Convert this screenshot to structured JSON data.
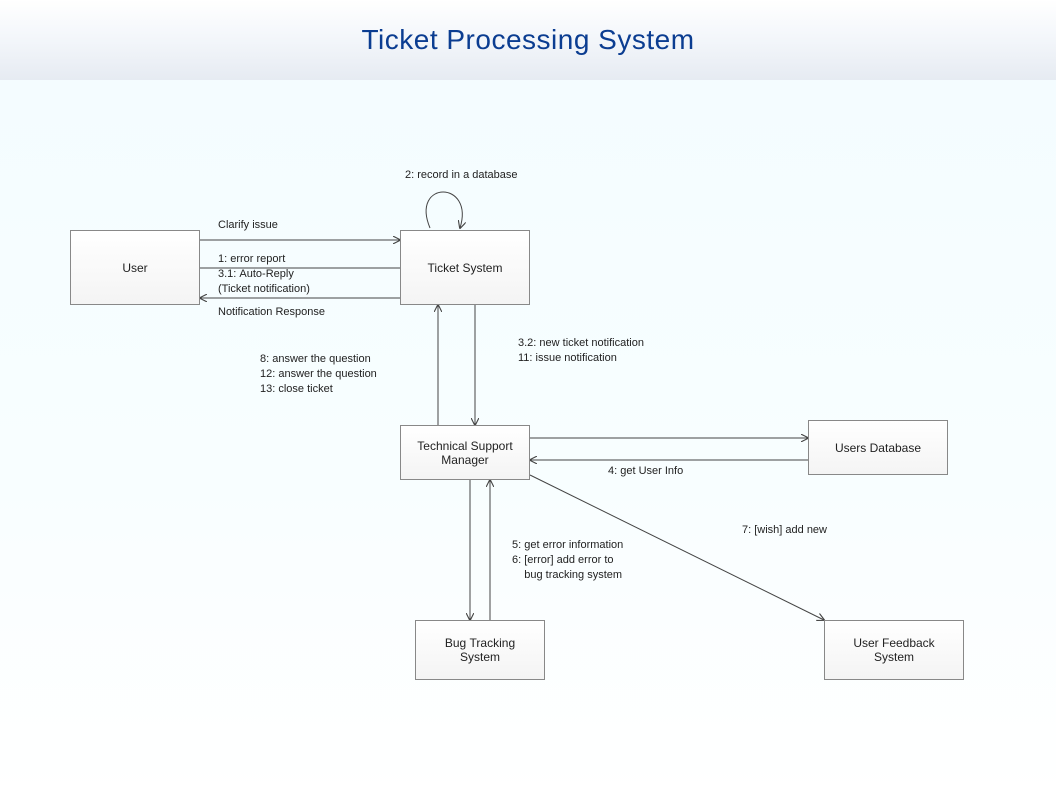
{
  "title": "Ticket Processing System",
  "nodes": {
    "user": "User",
    "ticketSystem": "Ticket System",
    "tsm": "Technical Support\nManager",
    "usersDb": "Users Database",
    "bugTracking": "Bug Tracking\nSystem",
    "userFeedback": "User Feedback\nSystem"
  },
  "labels": {
    "clarify": "Clarify issue",
    "errorReport": "1: error report\n3.1: Auto-Reply\n(Ticket notification)",
    "notifResp": "Notification Response",
    "record": "2: record in a database",
    "newTicket": "3.2: new ticket notification\n11: issue notification",
    "answer": "8: answer the question\n12: answer the question\n13: close ticket",
    "getUserInfo": "4: get User Info",
    "bugInfo": "5: get error information\n6: [error] add error to\n    bug tracking system",
    "wish": "7: [wish] add new"
  }
}
